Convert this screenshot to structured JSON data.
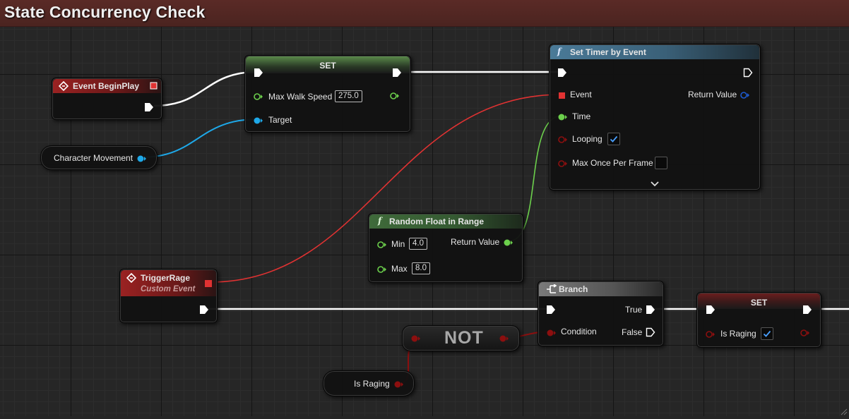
{
  "graph_title": "State Concurrency Check",
  "colors": {
    "exec": "#ffffff",
    "float": "#6cd04c",
    "object": "#1ea8e8",
    "delegate": "#e83a3a",
    "bool": "#8c0f0f"
  },
  "nodes": {
    "event_begin_play": {
      "title": "Event BeginPlay"
    },
    "set_walk": {
      "title": "SET",
      "max_walk_speed_label": "Max Walk Speed",
      "max_walk_speed_value": "275.0",
      "target_label": "Target"
    },
    "char_movement": {
      "label": "Character Movement"
    },
    "set_timer": {
      "title": "Set Timer by Event",
      "event_label": "Event",
      "return_label": "Return Value",
      "time_label": "Time",
      "looping_label": "Looping",
      "looping_checked": true,
      "max_once_label": "Max Once Per Frame",
      "max_once_checked": false
    },
    "random_float": {
      "title": "Random Float in Range",
      "min_label": "Min",
      "min_value": "4.0",
      "max_label": "Max",
      "max_value": "8.0",
      "return_label": "Return Value"
    },
    "trigger_rage": {
      "title": "TriggerRage",
      "subtitle": "Custom Event"
    },
    "branch": {
      "title": "Branch",
      "true_label": "True",
      "false_label": "False",
      "condition_label": "Condition"
    },
    "not": {
      "label": "NOT"
    },
    "is_raging_get": {
      "label": "Is Raging"
    },
    "set_raging": {
      "title": "SET",
      "is_raging_label": "Is Raging",
      "is_raging_checked": true
    }
  }
}
